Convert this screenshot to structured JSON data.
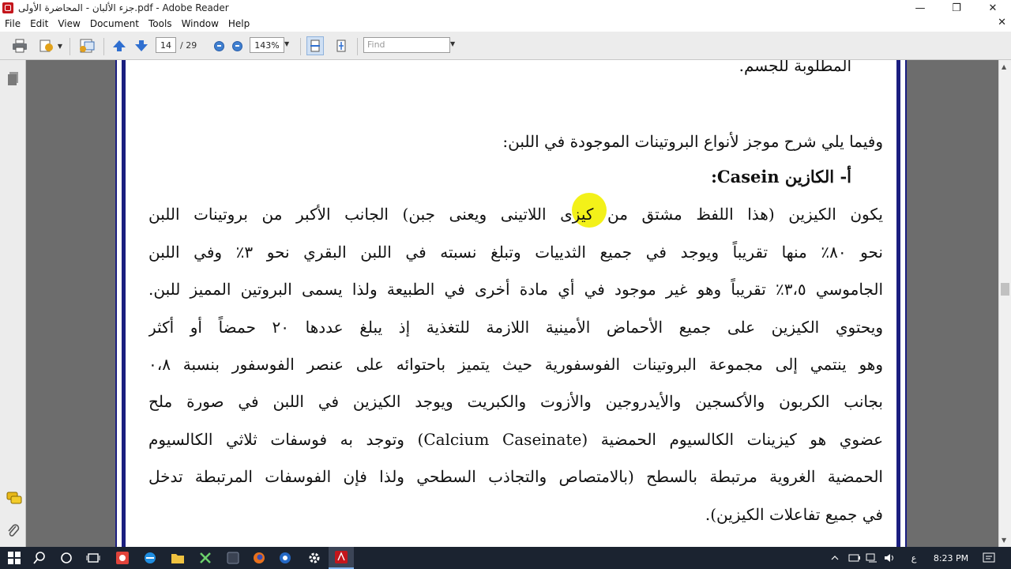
{
  "window": {
    "title": "جزء الألبان - المحاضرة الأولى.pdf - Adobe Reader",
    "controls": {
      "minimize": "—",
      "maximize": "❐",
      "close": "✕"
    }
  },
  "menu": {
    "items": [
      "File",
      "Edit",
      "View",
      "Document",
      "Tools",
      "Window",
      "Help"
    ],
    "close": "✕"
  },
  "toolbar": {
    "current_page": "14",
    "page_total": "/ 29",
    "zoom": "143%",
    "find_placeholder": "Find"
  },
  "document": {
    "top_partial": "المطلوبة للجسم.",
    "intro": "وفيما يلي شرح موجز  لأنواع البروتينات الموجودة في اللبن:",
    "section_heading": "أ-  الكازين Casein:",
    "paragraph_lines": [
      "يكون الكيزين (هذا اللفظ مشتق من كيزى اللاتينى ويعنى جبن) الجانب الأكبر من بروتينات اللبن",
      "نحو ٨٠٪ منها تقريباً ويوجد في جميع الثدييات وتبلغ نسبته في اللبن البقري نحو ٣٪ وفي اللبن",
      "الجاموسي ٣،٥٪ تقريباً وهو غير موجود في أي مادة أخرى في الطبيعة ولذا يسمى البروتين المميز للبن.",
      "ويحتوي الكيزين على جميع الأحماض الأمينية اللازمة للتغذية إذ يبلغ عددها ٢٠ حمضاً أو أكثر",
      "وهو ينتمي إلى مجموعة البروتينات الفوسفورية حيث يتميز باحتوائه على عنصر الفوسفور بنسبة ٠،٨",
      "بجانب الكربون والأكسجين والأيدروجين والأزوت والكبريت ويوجد الكيزين في اللبن في صورة ملح",
      "عضوي هو كيزينات الكالسيوم الحمضية (Calcium Caseinate) وتوجد به فوسفات ثلاثي الكالسيوم",
      "الحمضية الغروية مرتبطة بالسطح (بالامتصاص والتجاذب السطحي ولذا فإن الفوسفات المرتبطة تدخل",
      "في جميع تفاعلات الكيزين)."
    ]
  },
  "taskbar": {
    "time": "8:23 PM",
    "lang": "ع"
  },
  "colors": {
    "page_border": "#1b1f80",
    "highlight": "#f2f000",
    "taskbar": "#1b2330"
  }
}
